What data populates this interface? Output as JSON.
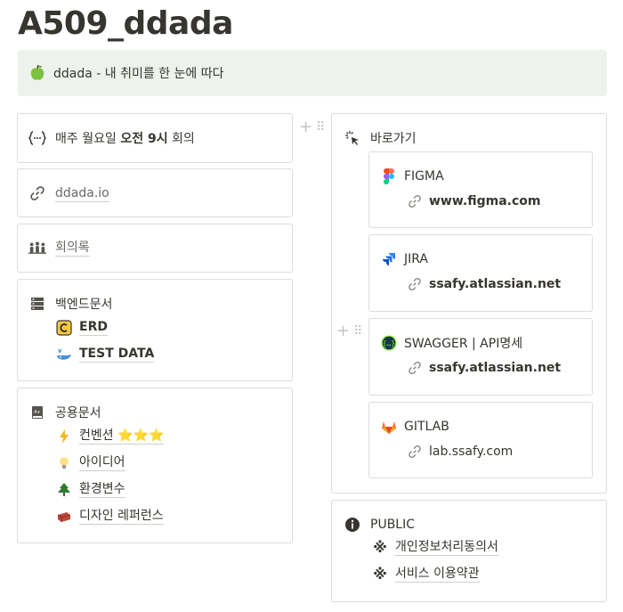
{
  "page": {
    "title": "A509_ddada"
  },
  "callout": {
    "text": "ddada - 내 취미를 한 눈에 따다",
    "icon": "green-apple-icon"
  },
  "left": {
    "meeting": {
      "prefix": "매주 월요일 ",
      "bold": "오전 9시",
      "suffix": " 회의",
      "icon": "code-braces-icon"
    },
    "site": {
      "label": "ddada.io",
      "icon": "link-icon"
    },
    "minutes": {
      "label": "회의록",
      "icon": "people-icon"
    },
    "backend": {
      "title": "백엔드문서",
      "icon": "server-icon",
      "items": [
        {
          "label": "ERD",
          "icon": "erd-icon"
        },
        {
          "label": "TEST DATA",
          "icon": "whale-icon"
        }
      ]
    },
    "shared": {
      "title": "공용문서",
      "icon": "book-icon",
      "items": [
        {
          "label": "컨벤션 ⭐⭐⭐",
          "icon": "lightning-icon"
        },
        {
          "label": "아이디어",
          "icon": "lightbulb-icon"
        },
        {
          "label": "환경변수",
          "icon": "tree-icon"
        },
        {
          "label": "디자인 레퍼런스",
          "icon": "brick-icon"
        }
      ]
    }
  },
  "right": {
    "shortcuts": {
      "title": "바로가기",
      "icon": "cursor-click-icon",
      "cards": [
        {
          "name": "FIGMA",
          "url": "www.figma.com",
          "icon": "figma-icon"
        },
        {
          "name": "JIRA",
          "url": "ssafy.atlassian.net",
          "icon": "jira-icon"
        },
        {
          "name": "SWAGGER | API명세",
          "url": "ssafy.atlassian.net",
          "icon": "swagger-icon"
        },
        {
          "name": "GITLAB",
          "url": "lab.ssafy.com",
          "icon": "gitlab-icon"
        }
      ]
    },
    "public": {
      "title": "PUBLIC",
      "icon": "info-icon",
      "items": [
        {
          "label": "개인정보처리동의서",
          "icon": "reference-mark-icon"
        },
        {
          "label": "서비스 이용약관",
          "icon": "reference-mark-icon"
        }
      ]
    }
  },
  "colors": {
    "callout_bg": "#edf3ec",
    "border": "#dcdcdc",
    "text": "#37352f",
    "muted": "#6b6a66"
  }
}
